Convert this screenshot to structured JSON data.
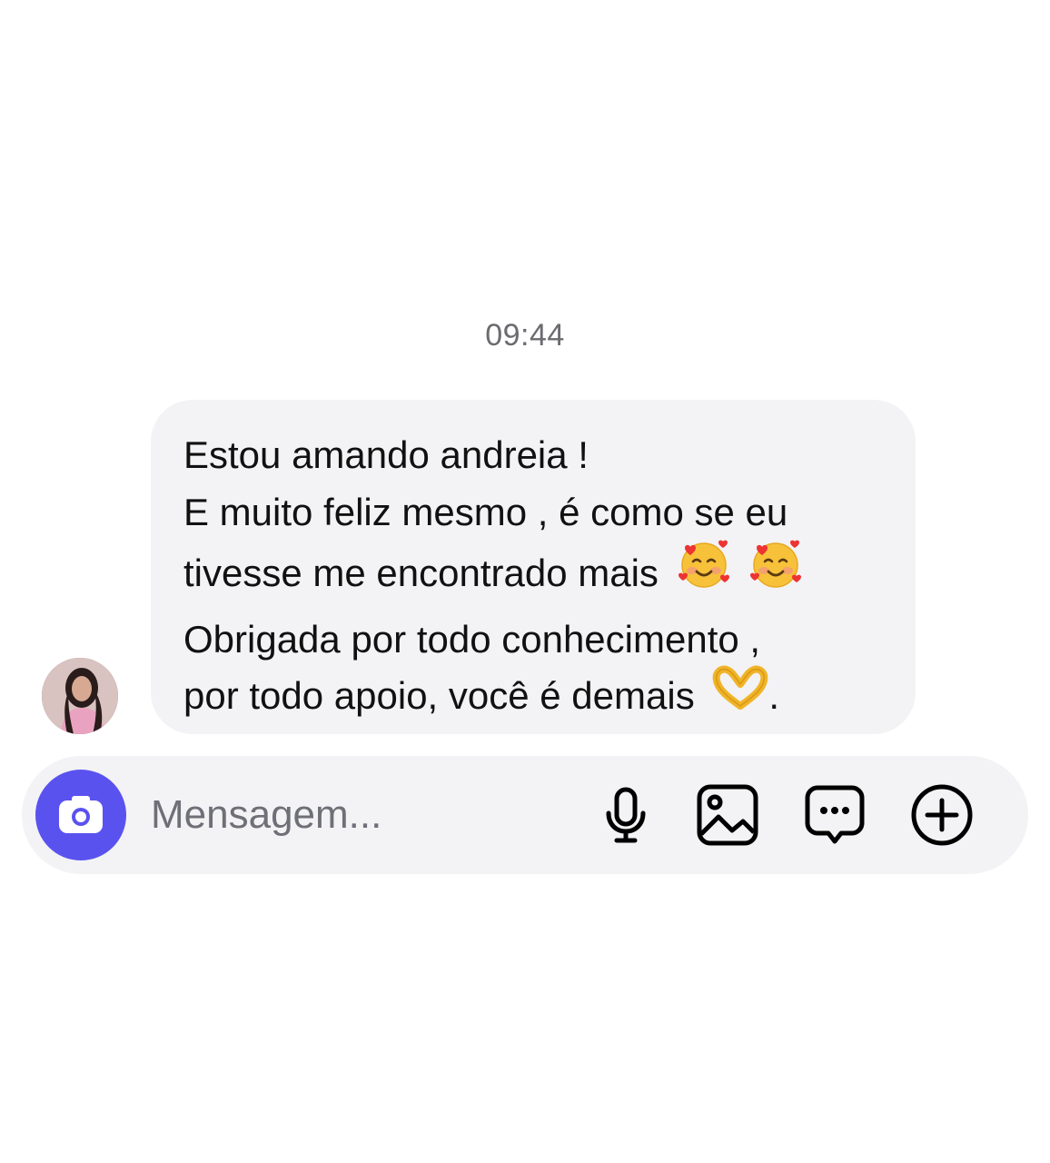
{
  "conversation": {
    "timestamp": "09:44"
  },
  "message": {
    "sender_avatar": "profile-photo",
    "lines": [
      {
        "text": "Estou amando andreia !"
      },
      {
        "text": "E muito feliz mesmo , é como se eu"
      },
      {
        "text": "tivesse me encontrado mais",
        "emojis": [
          "smiling-face-with-hearts",
          "smiling-face-with-hearts"
        ]
      },
      {
        "text": "Obrigada por todo conhecimento ,"
      },
      {
        "text": "por todo apoio, você é demais",
        "emojis": [
          "heart-hands"
        ],
        "suffix": "."
      }
    ]
  },
  "composer": {
    "placeholder": "Mensagem...",
    "value": "",
    "icons": [
      "camera-icon",
      "microphone-icon",
      "image-icon",
      "sticker-icon",
      "plus-circle-icon"
    ],
    "accent_color": "#5a52ef"
  }
}
